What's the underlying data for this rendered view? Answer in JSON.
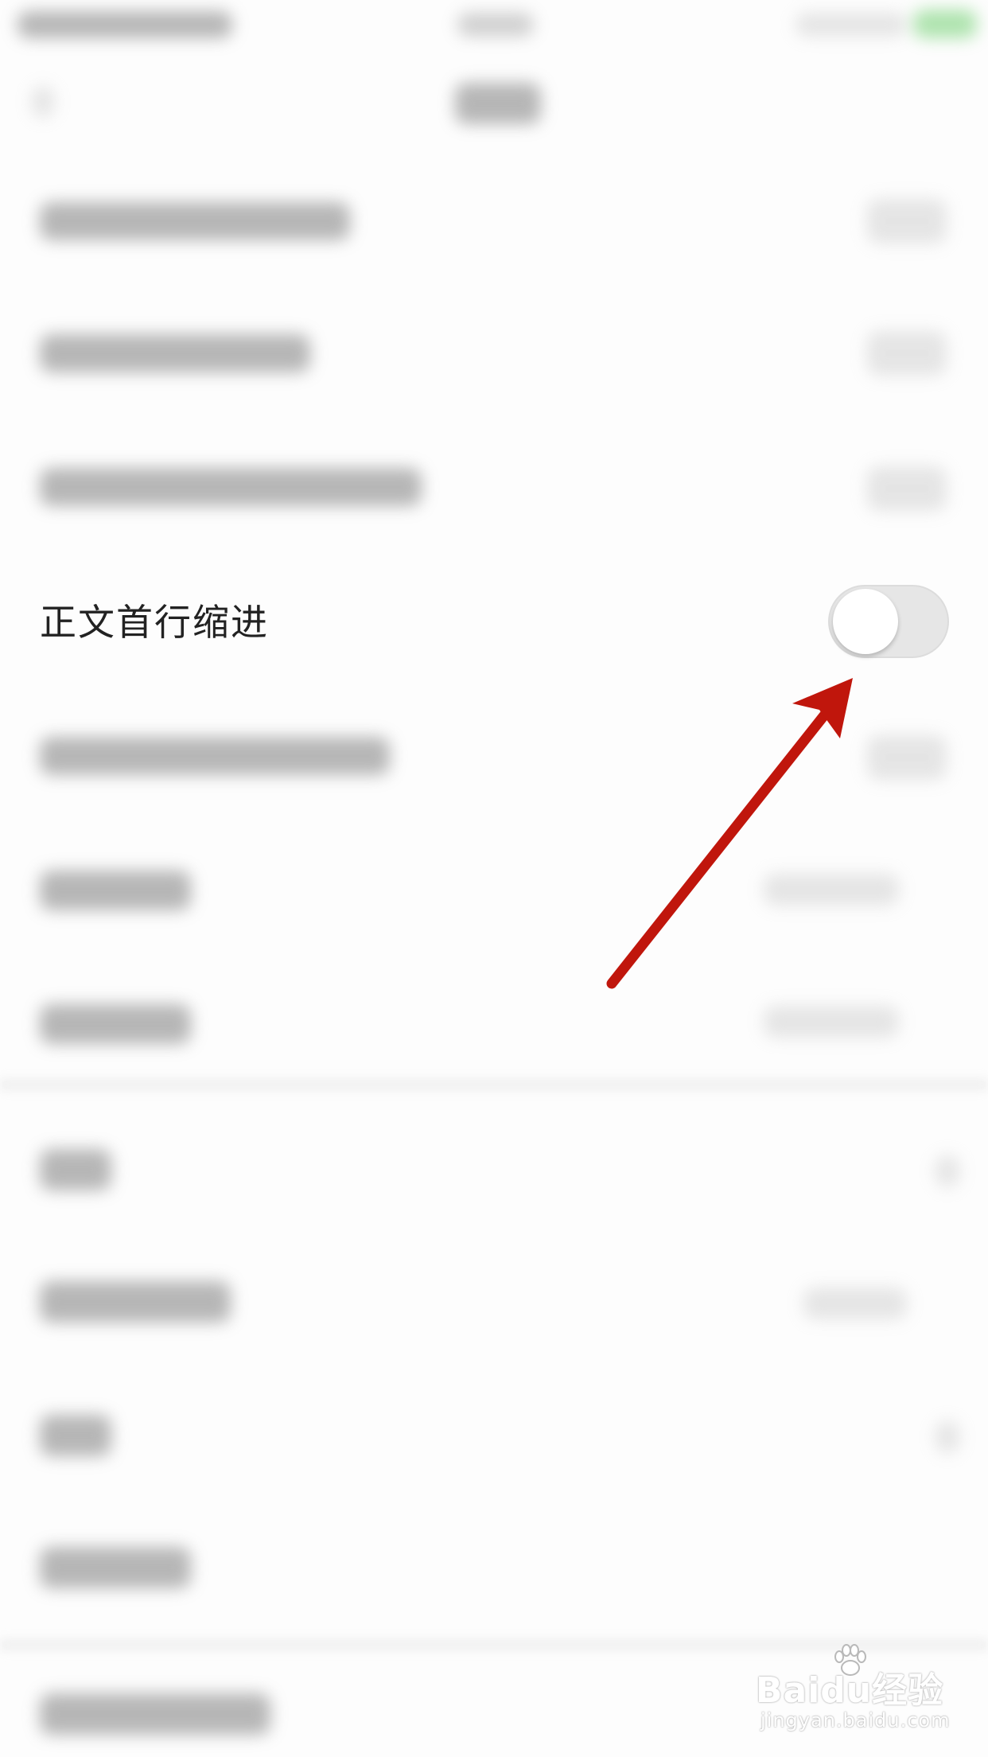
{
  "setting": {
    "label": "正文首行缩进",
    "toggle_on": false
  },
  "annotation": {
    "arrow_color": "#c0160c"
  },
  "watermark": {
    "logo_text": "Baidu经验",
    "url_text": "jingyan.baidu.com"
  },
  "colors": {
    "background": "#fdfdfd",
    "label_text": "#222222",
    "toggle_track": "#e6e6e6",
    "toggle_knob": "#ffffff"
  }
}
